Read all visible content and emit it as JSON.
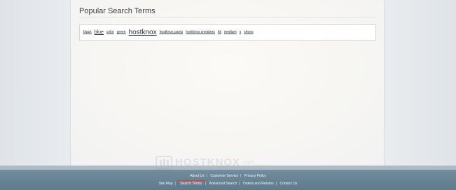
{
  "page": {
    "title": "Popular Search Terms"
  },
  "tags": [
    {
      "text": "black",
      "size": "s"
    },
    {
      "text": "blue",
      "size": "m"
    },
    {
      "text": "color",
      "size": "s"
    },
    {
      "text": "green",
      "size": "s"
    },
    {
      "text": "hostknox",
      "size": "l"
    },
    {
      "text": "hostknox pants",
      "size": "s"
    },
    {
      "text": "hostknox sneakers",
      "size": "s"
    },
    {
      "text": "kk",
      "size": "s"
    },
    {
      "text": "medium",
      "size": "s"
    },
    {
      "text": "s",
      "size": "s"
    },
    {
      "text": "shoes",
      "size": "s"
    }
  ],
  "footer": {
    "row1": [
      "About Us",
      "Customer Service",
      "Privacy Policy"
    ],
    "row2": [
      "Site Map",
      "Search Terms",
      "Advanced Search",
      "Orders and Returns",
      "Contact Us"
    ],
    "active": "Search Terms"
  },
  "watermark": {
    "text": "HOSTKNOX",
    "suffix": ".com"
  },
  "colors": {
    "footer": "#5f7c8d",
    "active_outline": "#c84848"
  }
}
